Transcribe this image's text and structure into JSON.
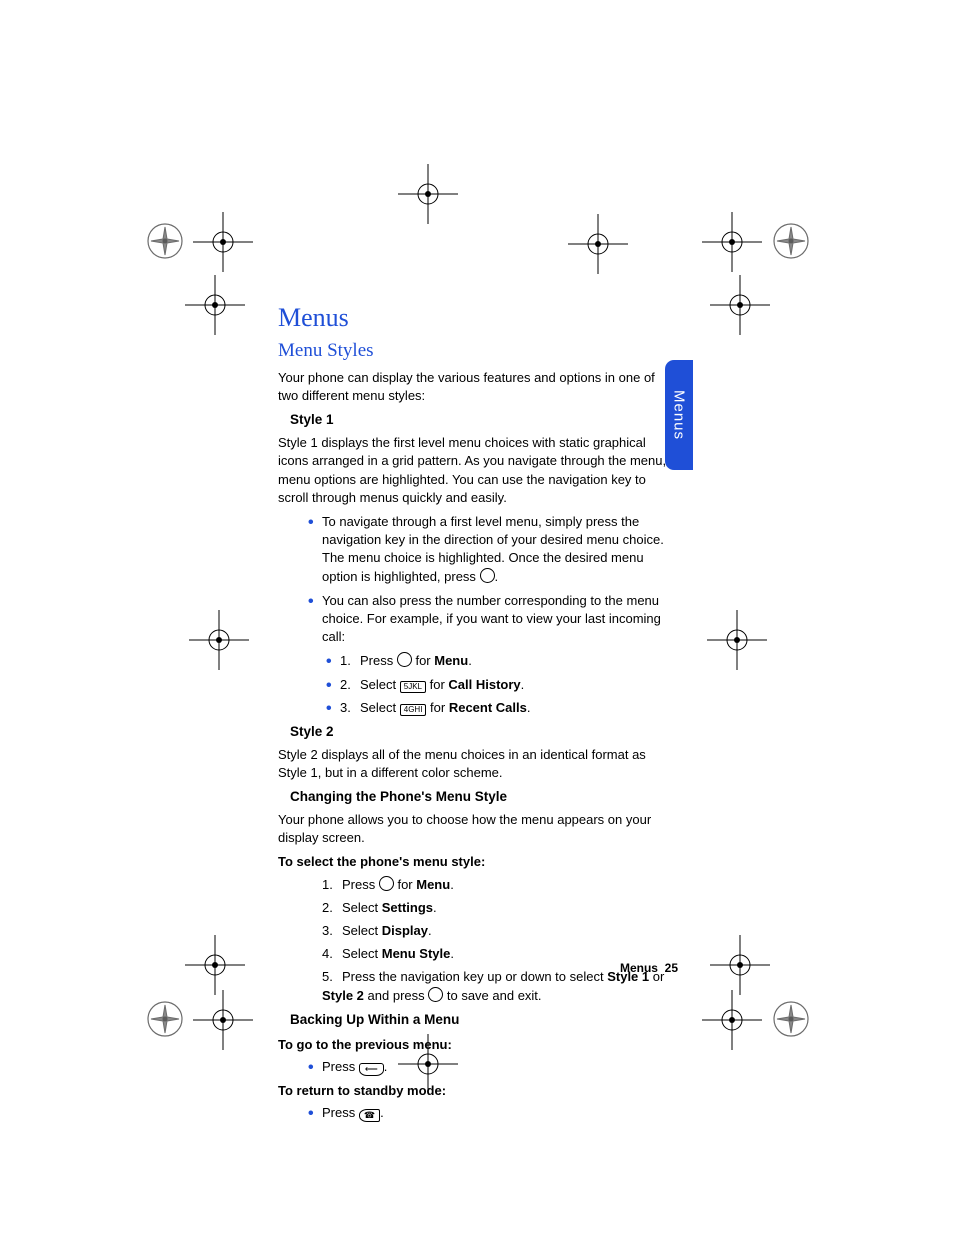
{
  "tab_label": "Menus",
  "chapter_title": "Menus",
  "section_title": "Menu Styles",
  "intro": "Your phone can display the various features and options in one of two different menu styles:",
  "style1": {
    "heading": "Style 1",
    "body": "Style 1 displays the first level menu choices with static graphical icons arranged in a grid pattern. As you navigate through the menu, menu options are highlighted. You can use the navigation key to scroll through menus quickly and easily.",
    "bullet1_a": "To navigate through a first level menu, simply press the navigation key in the direction of your desired menu choice. The menu choice is highlighted. Once the desired menu option is highlighted, press ",
    "bullet1_b": ".",
    "bullet2": "You can also press the number corresponding to the menu choice. For example, if you want to view your last incoming call:",
    "steps": {
      "s1_a": "Press ",
      "s1_b": " for ",
      "s1_bold": "Menu",
      "s1_c": ".",
      "s2_a": "Select ",
      "s2_key": "5JKL",
      "s2_b": " for ",
      "s2_bold": "Call History",
      "s2_c": ".",
      "s3_a": "Select ",
      "s3_key": "4GHI",
      "s3_b": " for ",
      "s3_bold": "Recent Calls",
      "s3_c": "."
    }
  },
  "style2": {
    "heading": "Style 2",
    "body": "Style 2 displays all of the menu choices in an identical format as Style 1, but in a different color scheme."
  },
  "changing": {
    "heading": "Changing the Phone's Menu Style",
    "body": "Your phone allows you to choose how the menu appears on your display screen.",
    "runin": "To select the phone's menu style:",
    "steps": {
      "s1_a": "Press ",
      "s1_b": " for ",
      "s1_bold": "Menu",
      "s1_c": ".",
      "s2_a": "Select ",
      "s2_bold": "Settings",
      "s2_b": ".",
      "s3_a": "Select ",
      "s3_bold": "Display",
      "s3_b": ".",
      "s4_a": "Select ",
      "s4_bold": "Menu Style",
      "s4_b": ".",
      "s5_a": "Press the navigation key up or down to select ",
      "s5_bold1": "Style 1",
      "s5_mid": " or ",
      "s5_bold2": "Style 2",
      "s5_b": " and press ",
      "s5_c": " to save and exit."
    }
  },
  "backing": {
    "heading": "Backing Up Within a Menu",
    "runin1": "To go to the previous menu:",
    "b1_a": "Press ",
    "b1_key": "⟵",
    "b1_b": ".",
    "runin2": "To return to standby mode:",
    "b2_a": "Press ",
    "b2_key": "☎",
    "b2_b": "."
  },
  "footer": {
    "label": "Menus",
    "num": "25"
  }
}
